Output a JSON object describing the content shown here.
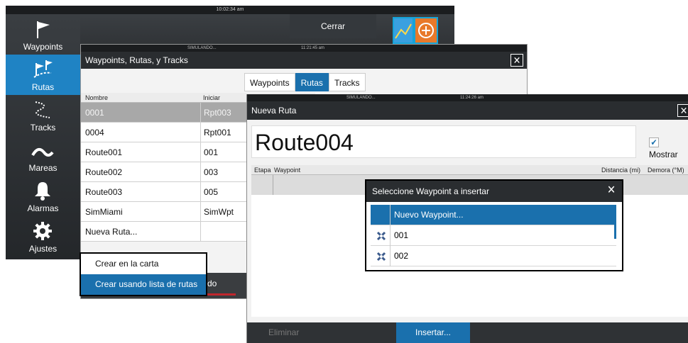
{
  "background_window": {
    "clock": "10:02:34 am",
    "close_label": "Cerrar",
    "sidebar": [
      {
        "label": "Waypoints",
        "icon": "flag-icon",
        "active": false
      },
      {
        "label": "Rutas",
        "icon": "route-flags-icon",
        "active": true
      },
      {
        "label": "Tracks",
        "icon": "track-icon",
        "active": false
      },
      {
        "label": "Mareas",
        "icon": "wave-icon",
        "active": false
      },
      {
        "label": "Alarmas",
        "icon": "bell-icon",
        "active": false
      },
      {
        "label": "Ajustes",
        "icon": "gear-icon",
        "active": false
      }
    ]
  },
  "wrt_window": {
    "status": "SIMULANDO...",
    "clock": "11:21:45 am",
    "title": "Waypoints, Rutas, y Tracks",
    "tabs": [
      {
        "label": "Waypoints",
        "active": false
      },
      {
        "label": "Rutas",
        "active": true
      },
      {
        "label": "Tracks",
        "active": false
      }
    ],
    "columns": [
      "Nombre",
      "Iniciar"
    ],
    "rows": [
      {
        "name": "0001",
        "start": "Rpt003",
        "selected": true
      },
      {
        "name": "0004",
        "start": "Rpt001",
        "selected": false
      },
      {
        "name": "Route001",
        "start": "001",
        "selected": false
      },
      {
        "name": "Route002",
        "start": "003",
        "selected": false
      },
      {
        "name": "Route003",
        "start": "005",
        "selected": false
      },
      {
        "name": "SimMiami",
        "start": "SimWpt",
        "selected": false
      },
      {
        "name": "Nueva Ruta...",
        "start": "",
        "selected": false
      }
    ],
    "bottom_fragment": "do"
  },
  "create_menu": {
    "items": [
      {
        "label": "Crear en la carta",
        "highlighted": false
      },
      {
        "label": "Crear usando lista de rutas",
        "highlighted": true
      }
    ]
  },
  "new_route_window": {
    "status": "SIMULANDO...",
    "clock": "11:24:26 am",
    "title": "Nueva Ruta",
    "route_name": "Route004",
    "show_label": "Mostrar",
    "show_checked": true,
    "columns": [
      "Etapa",
      "Waypoint",
      "Distancia (mi)",
      "Demora (°M)"
    ],
    "delete_label": "Eliminar",
    "insert_label": "Insertar..."
  },
  "waypoint_dialog": {
    "title": "Seleccione Waypoint a insertar",
    "items": [
      {
        "label": "Nuevo Waypoint...",
        "highlighted": true
      },
      {
        "label": "001",
        "highlighted": false
      },
      {
        "label": "002",
        "highlighted": false
      }
    ]
  },
  "colors": {
    "accent": "#1a70ad",
    "sidebar_active": "#1f83c4",
    "dark_bar": "#2a2d30"
  }
}
